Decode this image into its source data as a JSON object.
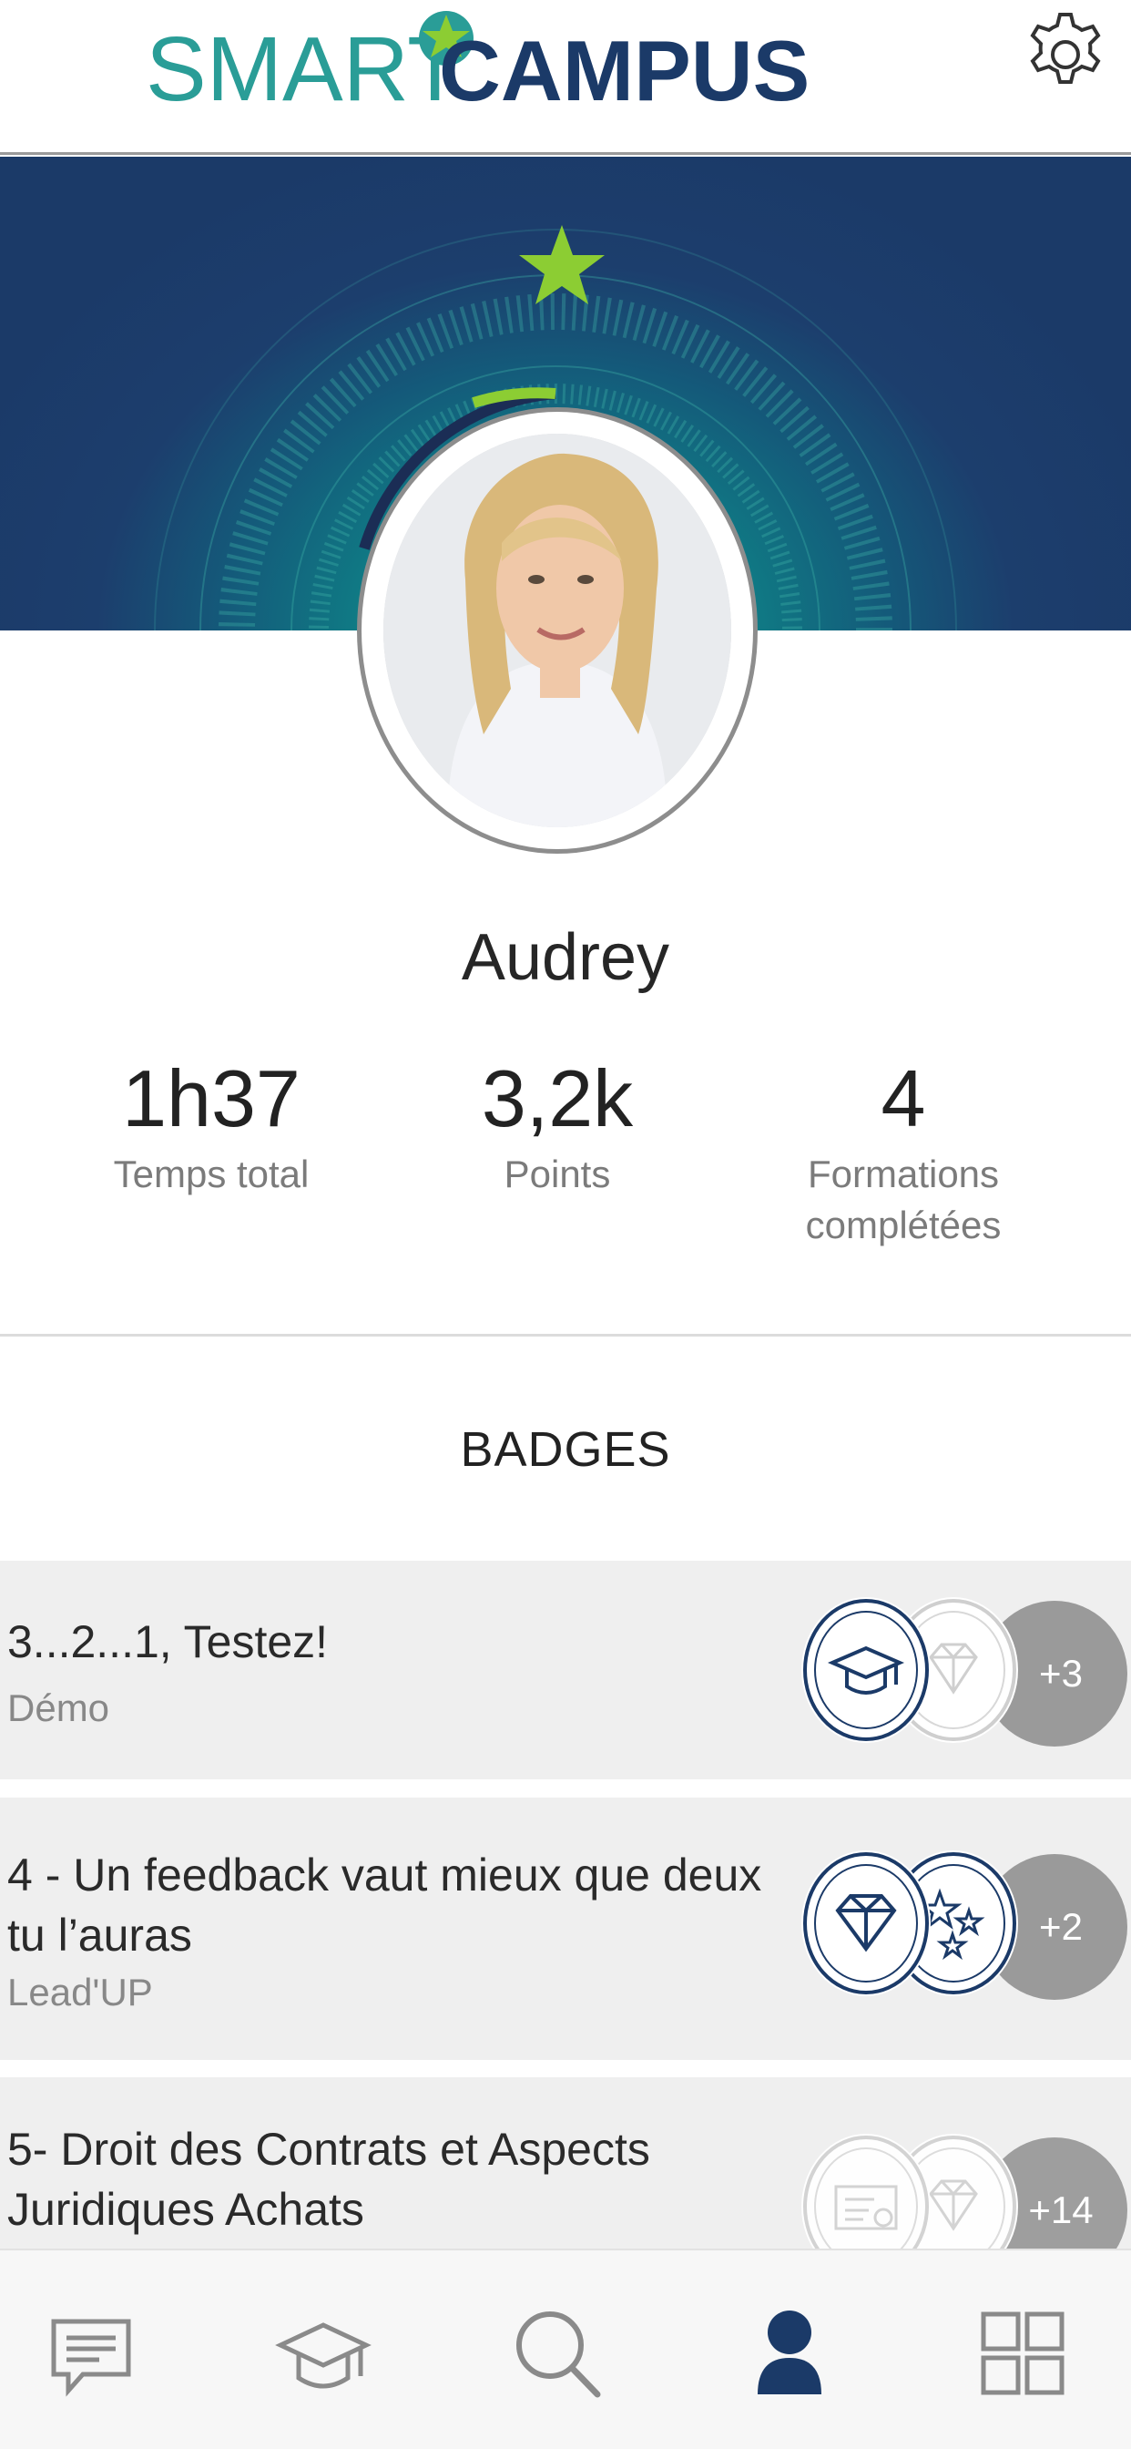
{
  "header": {
    "logo_left": "SMART",
    "logo_right": "CAMPUS",
    "settings_icon": "gear-icon"
  },
  "colors": {
    "brand_teal": "#2a9d97",
    "brand_navy": "#1b3a68",
    "star_green": "#8ccd33",
    "badge_more_gray": "#9a9a9a"
  },
  "profile": {
    "name": "Audrey",
    "avatar_icon": "profile-photo"
  },
  "stats": [
    {
      "value": "1h37",
      "label": "Temps total"
    },
    {
      "value": "3,2k",
      "label": "Points"
    },
    {
      "value": "4",
      "label_line1": "Formations",
      "label_line2": "complétées"
    }
  ],
  "badges": {
    "title": "BADGES",
    "items": [
      {
        "title": "3...2...1, Testez!",
        "subtitle": "Démo",
        "more": "+3",
        "icons": [
          "graduation-cap-icon",
          "diamond-icon"
        ]
      },
      {
        "title_line1": "4 - Un feedback vaut mieux que deux",
        "title_line2": "tu l’auras",
        "subtitle": "Lead'UP",
        "more": "+2",
        "icons": [
          "diamond-icon",
          "stars-icon"
        ]
      },
      {
        "title_line1": "5- Droit des Contrats et Aspects",
        "title_line2": "Juridiques Achats",
        "more": "+14",
        "icons": [
          "certificate-icon",
          "diamond-icon"
        ]
      }
    ]
  },
  "nav": {
    "items": [
      "chat-icon",
      "graduation-cap-icon",
      "search-icon",
      "user-icon",
      "grid-icon"
    ],
    "active": "user-icon"
  }
}
